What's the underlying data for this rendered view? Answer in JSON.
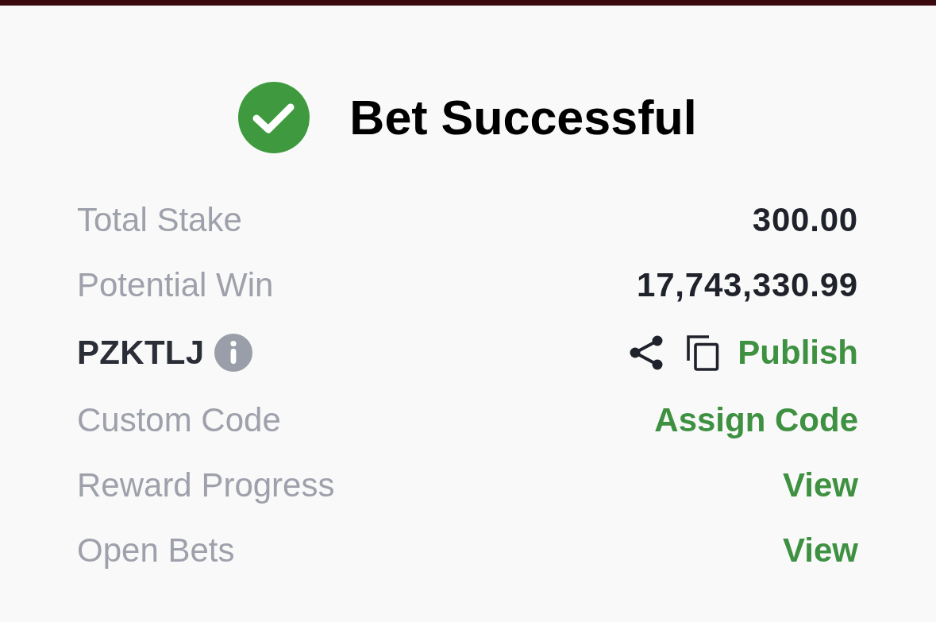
{
  "header": {
    "title": "Bet Successful"
  },
  "rows": [
    {
      "kind": "value",
      "label": "Total Stake",
      "value": "300.00"
    },
    {
      "kind": "value",
      "label": "Potential Win",
      "value": "17,743,330.99"
    },
    {
      "kind": "code",
      "code": "PZKTLJ",
      "action": "Publish"
    },
    {
      "kind": "link",
      "label": "Custom Code",
      "action": "Assign Code"
    },
    {
      "kind": "link",
      "label": "Reward Progress",
      "action": "View"
    },
    {
      "kind": "link",
      "label": "Open Bets",
      "action": "View"
    }
  ]
}
